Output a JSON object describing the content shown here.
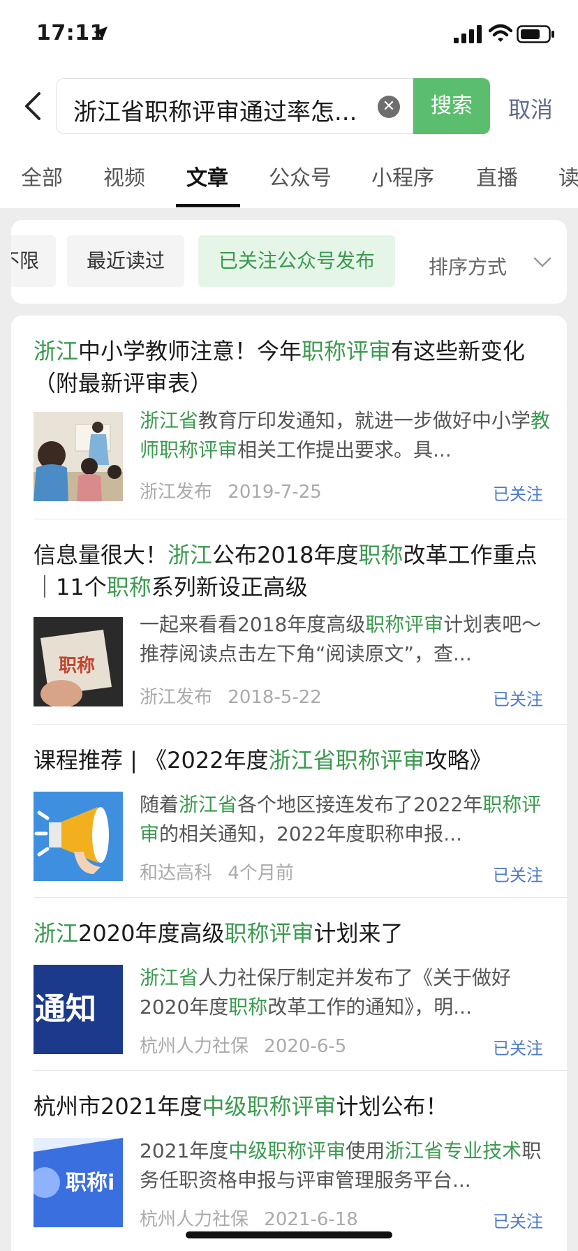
{
  "status_bar": {
    "time": "17:11"
  },
  "search": {
    "query": "浙江省职称评审通过率怎...",
    "clear_glyph": "✕",
    "button": "搜索",
    "cancel": "取消"
  },
  "tabs": [
    {
      "label": "全部",
      "active": false
    },
    {
      "label": "视频",
      "active": false
    },
    {
      "label": "文章",
      "active": true
    },
    {
      "label": "公众号",
      "active": false
    },
    {
      "label": "小程序",
      "active": false
    },
    {
      "label": "直播",
      "active": false
    },
    {
      "label": "读",
      "active": false
    }
  ],
  "filters": {
    "chips": [
      "不限",
      "最近读过",
      "已关注公众号发布"
    ],
    "selected": "已关注公众号发布",
    "sort": "排序方式"
  },
  "articles": [
    {
      "title": [
        {
          "t": "浙江",
          "hl": true
        },
        {
          "t": "中小学教师注意！今年",
          "hl": false
        },
        {
          "t": "职称评审",
          "hl": true
        },
        {
          "t": "有这些新变化（附最新评审表）",
          "hl": false
        }
      ],
      "excerpt": [
        {
          "t": "浙江省",
          "hl": true
        },
        {
          "t": "教育厅印发通知，就进一步做好中小学",
          "hl": false
        },
        {
          "t": "教师职称评审",
          "hl": true
        },
        {
          "t": "相关工作提出要求。具...",
          "hl": false
        }
      ],
      "source": "浙江发布",
      "date": "2019-7-25",
      "follow": "已关注"
    },
    {
      "title": [
        {
          "t": "信息量很大！",
          "hl": false
        },
        {
          "t": "浙江",
          "hl": true
        },
        {
          "t": "公布2018年度",
          "hl": false
        },
        {
          "t": "职称",
          "hl": true
        },
        {
          "t": "改革工作重点｜11个",
          "hl": false
        },
        {
          "t": "职称",
          "hl": true
        },
        {
          "t": "系列新设正高级",
          "hl": false
        }
      ],
      "excerpt": [
        {
          "t": "一起来看看2018年度高级",
          "hl": false
        },
        {
          "t": "职称评审",
          "hl": true
        },
        {
          "t": "计划表吧～推荐阅读点击左下角“阅读原文”，查...",
          "hl": false
        }
      ],
      "source": "浙江发布",
      "date": "2018-5-22",
      "follow": "已关注",
      "thumb_text": "职称"
    },
    {
      "title": [
        {
          "t": "课程推荐 | 《2022年度",
          "hl": false
        },
        {
          "t": "浙江省职称评审",
          "hl": true
        },
        {
          "t": "攻略》",
          "hl": false
        }
      ],
      "excerpt": [
        {
          "t": "随着",
          "hl": false
        },
        {
          "t": "浙江省",
          "hl": true
        },
        {
          "t": "各个地区接连发布了2022年",
          "hl": false
        },
        {
          "t": "职称评审",
          "hl": true
        },
        {
          "t": "的相关通知，2022年度职称申报...",
          "hl": false
        }
      ],
      "source": "和达高科",
      "date": "4个月前",
      "follow": "已关注"
    },
    {
      "title": [
        {
          "t": "浙江",
          "hl": true
        },
        {
          "t": "2020年度高级",
          "hl": false
        },
        {
          "t": "职称评审",
          "hl": true
        },
        {
          "t": "计划来了",
          "hl": false
        }
      ],
      "excerpt": [
        {
          "t": "浙江省",
          "hl": true
        },
        {
          "t": "人力社保厅制定并发布了《关于做好2020年度",
          "hl": false
        },
        {
          "t": "职称",
          "hl": true
        },
        {
          "t": "改革工作的通知》，明...",
          "hl": false
        }
      ],
      "source": "杭州人力社保",
      "date": "2020-6-5",
      "follow": "已关注",
      "thumb_text": "通知"
    },
    {
      "title": [
        {
          "t": "杭州市2021年度",
          "hl": false
        },
        {
          "t": "中级职称评审",
          "hl": true
        },
        {
          "t": "计划公布！",
          "hl": false
        }
      ],
      "excerpt": [
        {
          "t": "2021年度",
          "hl": false
        },
        {
          "t": "中级职称评审",
          "hl": true
        },
        {
          "t": "使用",
          "hl": false
        },
        {
          "t": "浙江省专业技术",
          "hl": true
        },
        {
          "t": "职务任职资格申报与评审管理服务平台...",
          "hl": false
        }
      ],
      "source": "杭州人力社保",
      "date": "2021-6-18",
      "follow": "已关注",
      "thumb_text": "职称i"
    }
  ],
  "colors": {
    "highlight": "#3a9a4e",
    "search_button": "#5bbd6e",
    "follow": "#4a79c9"
  }
}
